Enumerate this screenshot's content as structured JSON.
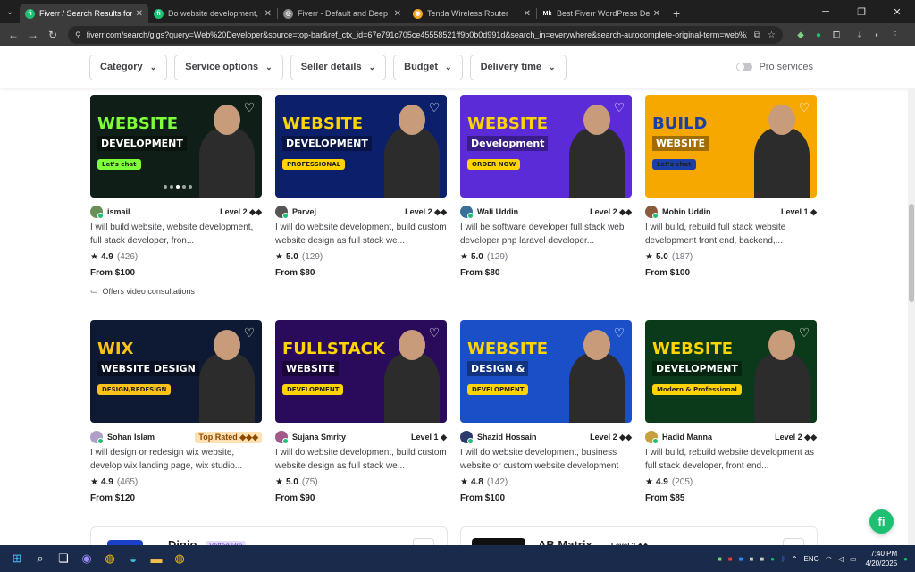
{
  "browser": {
    "tabs": [
      {
        "title": "Fiverr / Search Results for 'Web",
        "color": "#1dbf73",
        "glyph": "fi",
        "active": true
      },
      {
        "title": "Do website development, deve",
        "color": "#1dbf73",
        "glyph": "fi",
        "active": false
      },
      {
        "title": "Fiverr - Default and Deep Links",
        "color": "#888888",
        "glyph": "◎",
        "active": false
      },
      {
        "title": "Tenda Wireless Router",
        "color": "#f5a623",
        "glyph": "◉",
        "active": false
      },
      {
        "title": "Best Fiverr WordPress Develope",
        "color": "#222222",
        "glyph": "Mk",
        "active": false
      }
    ],
    "url": "fiverr.com/search/gigs?query=Web%20Developer&source=top-bar&ref_ctx_id=67e791c705ce45558521ff9b0b0d991d&search_in=everywhere&search-autocomplete-original-term=web%20dev..."
  },
  "filters": {
    "category": "Category",
    "service_options": "Service options",
    "seller_details": "Seller details",
    "budget": "Budget",
    "delivery_time": "Delivery time",
    "pro_services": "Pro services"
  },
  "gigs": [
    {
      "seller": "ismail",
      "level": "Level 2 ◆◆",
      "desc": "I will build website, website development, full stack developer, fron...",
      "rating": "4.9",
      "count": "(426)",
      "price": "From $100",
      "video": "Offers video consultations",
      "thumb_title": "WEBSITE",
      "thumb_sub": "DEVELOPMENT",
      "thumb_extra": "Let's chat",
      "bg": "#0f1f17",
      "accent": "#7dff3a",
      "avatar": "#6a8f5a"
    },
    {
      "seller": "Parvej",
      "level": "Level 2 ◆◆",
      "desc": "I will do website development, build custom website design as full stack we...",
      "rating": "5.0",
      "count": "(129)",
      "price": "From $80",
      "thumb_title": "WEBSITE",
      "thumb_sub": "DEVELOPMENT",
      "thumb_extra": "PROFESSIONAL",
      "bg": "#0b1f6b",
      "accent": "#ffd400",
      "avatar": "#555555"
    },
    {
      "seller": "Wali Uddin",
      "level": "Level 2 ◆◆",
      "desc": "I will be software developer full stack web developer php laravel developer...",
      "rating": "5.0",
      "count": "(129)",
      "price": "From $80",
      "thumb_title": "WEBSITE",
      "thumb_sub": "Development",
      "thumb_extra": "ORDER NOW",
      "bg": "#5a2bd6",
      "accent": "#ffd400",
      "avatar": "#3a6f9a"
    },
    {
      "seller": "Mohin Uddin",
      "level": "Level 1 ◆",
      "desc": "I will build, rebuild full stack website development front end, backend,...",
      "rating": "5.0",
      "count": "(187)",
      "price": "From $100",
      "thumb_title": "BUILD",
      "thumb_sub": "WEBSITE",
      "thumb_extra": "Let's chat",
      "bg": "#f7a800",
      "accent": "#1a3fa8",
      "avatar": "#8a5a3a"
    },
    {
      "seller": "Sohan Islam",
      "level": "Top Rated ◆◆◆",
      "top": true,
      "desc": "I will design or redesign wix website, develop wix landing page, wix studio...",
      "rating": "4.9",
      "count": "(465)",
      "price": "From $120",
      "thumb_title": "WIX",
      "thumb_sub": "WEBSITE DESIGN",
      "thumb_extra": "DESIGN/REDESIGN",
      "bg": "#0e1a33",
      "accent": "#ffc21a",
      "avatar": "#b0a0c8"
    },
    {
      "seller": "Sujana Smrity",
      "level": "Level 1 ◆",
      "desc": "I will do website development, build custom website design as full stack we...",
      "rating": "5.0",
      "count": "(75)",
      "price": "From $90",
      "thumb_title": "FULLSTACK",
      "thumb_sub": "WEBSITE",
      "thumb_extra": "DEVELOPMENT",
      "bg": "#2a0a5a",
      "accent": "#ffd400",
      "avatar": "#a05a8a"
    },
    {
      "seller": "Shazid Hossain",
      "level": "Level 2 ◆◆",
      "desc": "I will do website development, business website or custom website development",
      "rating": "4.8",
      "count": "(142)",
      "price": "From $100",
      "thumb_title": "WEBSITE",
      "thumb_sub": "DESIGN &",
      "thumb_extra": "DEVELOPMENT",
      "bg": "#1a4fc8",
      "accent": "#ffd400",
      "avatar": "#2a3a6a"
    },
    {
      "seller": "Hadid Manna",
      "level": "Level 2 ◆◆",
      "desc": "I will build, rebuild website development as full stack developer, front end...",
      "rating": "4.9",
      "count": "(205)",
      "price": "From $85",
      "thumb_title": "WEBSITE",
      "thumb_sub": "DEVELOPMENT",
      "thumb_extra": "Modern & Professional",
      "bg": "#0a3a1a",
      "accent": "#ffd400",
      "avatar": "#c8a040"
    }
  ],
  "agencies": [
    {
      "name": "Digio",
      "badge": "Vetted Pro"
    },
    {
      "name": "AB Matrix",
      "badge": "Level 2 ◆◆"
    }
  ],
  "taskbar": {
    "lang": "ENG",
    "time": "7:40 PM",
    "date": "4/20/2025"
  }
}
